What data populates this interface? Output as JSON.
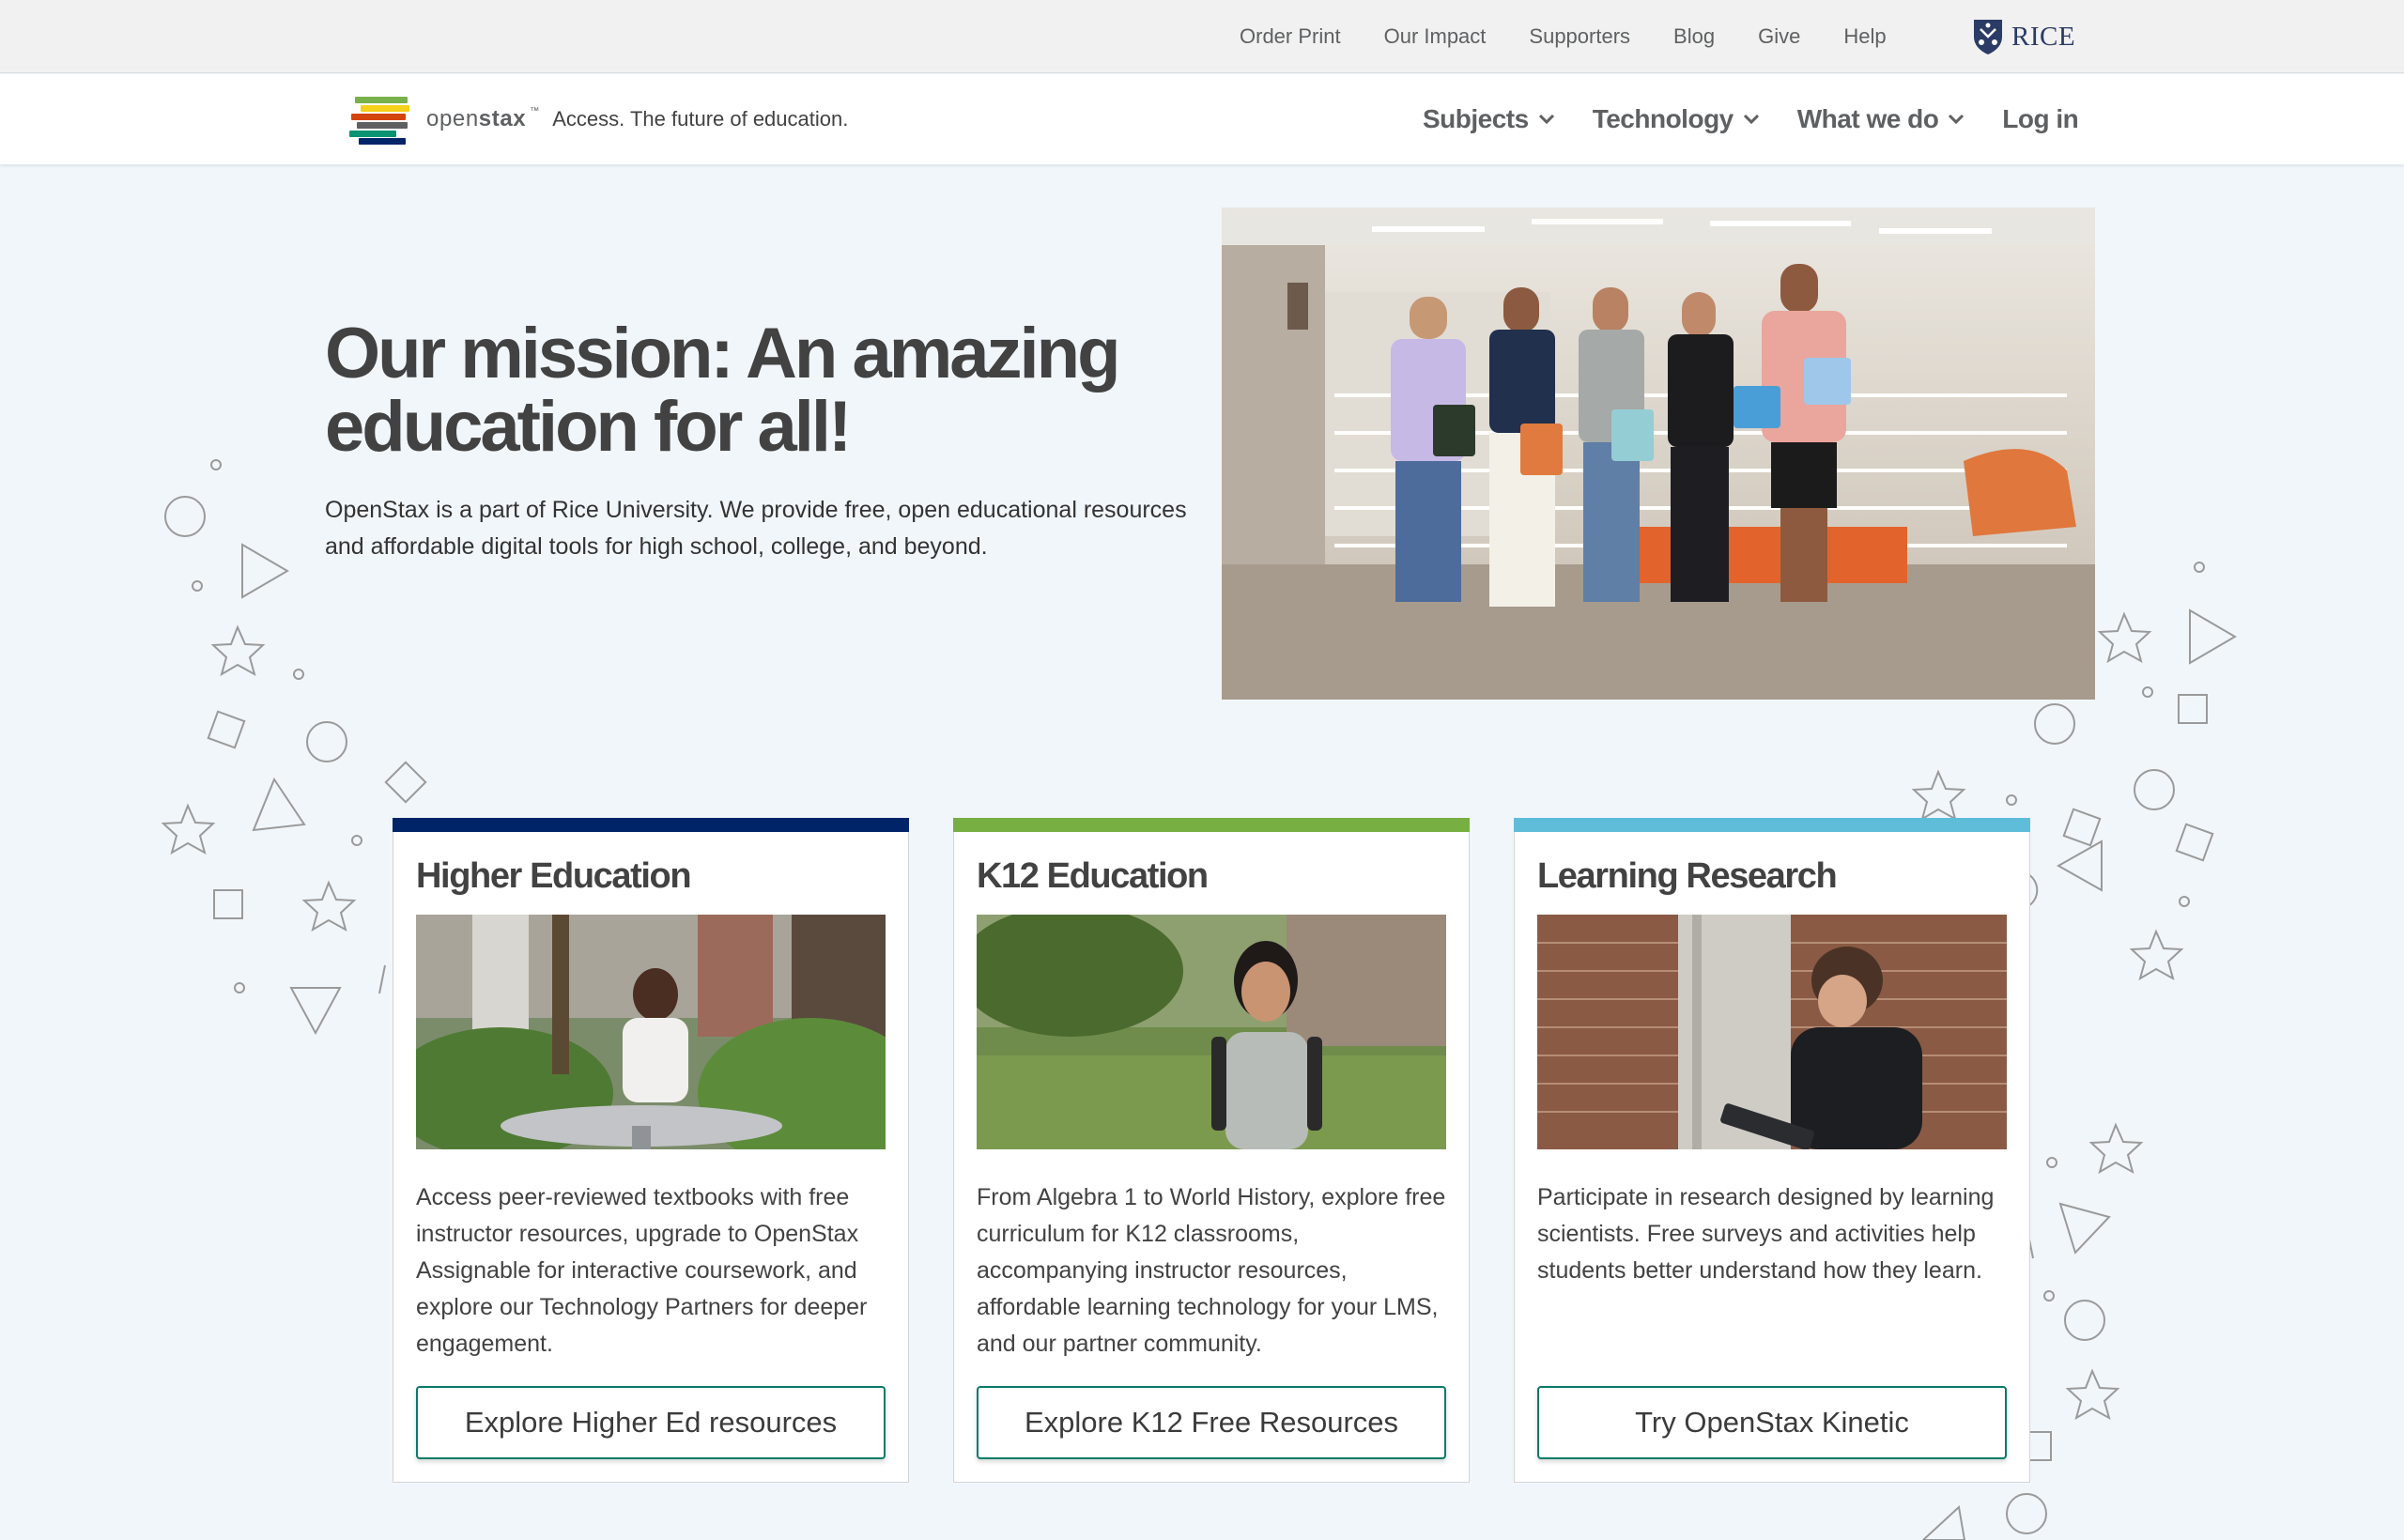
{
  "utility_nav": {
    "links": [
      "Order Print",
      "Our Impact",
      "Supporters",
      "Blog",
      "Give",
      "Help"
    ],
    "partner_logo": "RICE"
  },
  "brand": {
    "name_light": "open",
    "name_bold": "stax",
    "trademark": "™",
    "tagline": "Access. The future of education.",
    "book_colors": [
      "#78b04a",
      "#f4d019",
      "#d4450c",
      "#5e6062",
      "#0c9372",
      "#002468"
    ]
  },
  "main_nav": {
    "items": [
      {
        "label": "Subjects",
        "has_dropdown": true
      },
      {
        "label": "Technology",
        "has_dropdown": true
      },
      {
        "label": "What we do",
        "has_dropdown": true
      },
      {
        "label": "Log in",
        "has_dropdown": false
      }
    ]
  },
  "hero": {
    "title_line1": "Our mission: An amazing",
    "title_line2": "education for all!",
    "description": "OpenStax is a part of Rice University. We provide free, open educational resources and affordable digital tools for high school, college, and beyond.",
    "photo_icon": "students-group-photo"
  },
  "cards": [
    {
      "title": "Higher Education",
      "accent": "#002468",
      "photo_icon": "student-studying-photo",
      "description": "Access peer-reviewed textbooks with free instructor resources, upgrade to OpenStax Assignable for interactive coursework, and explore our Technology Partners for deeper engagement.",
      "button": "Explore Higher Ed resources"
    },
    {
      "title": "K12 Education",
      "accent": "#77af42",
      "photo_icon": "smiling-student-photo",
      "description": "From Algebra 1 to World History, explore free curriculum for K12 classrooms, accompanying instructor resources, affordable learning technology for your LMS, and our partner community.",
      "button": "Explore K12 Free Resources"
    },
    {
      "title": "Learning Research",
      "accent": "#5fbdd9",
      "photo_icon": "student-writing-tablet-photo",
      "description": "Participate in research designed by learning scientists. Free surveys and activities help students better understand how they learn.",
      "button": "Try OpenStax Kinetic"
    }
  ],
  "colors": {
    "page_background": "#f1f6fb",
    "button_border": "#0b7a6b",
    "text": "#424242"
  }
}
